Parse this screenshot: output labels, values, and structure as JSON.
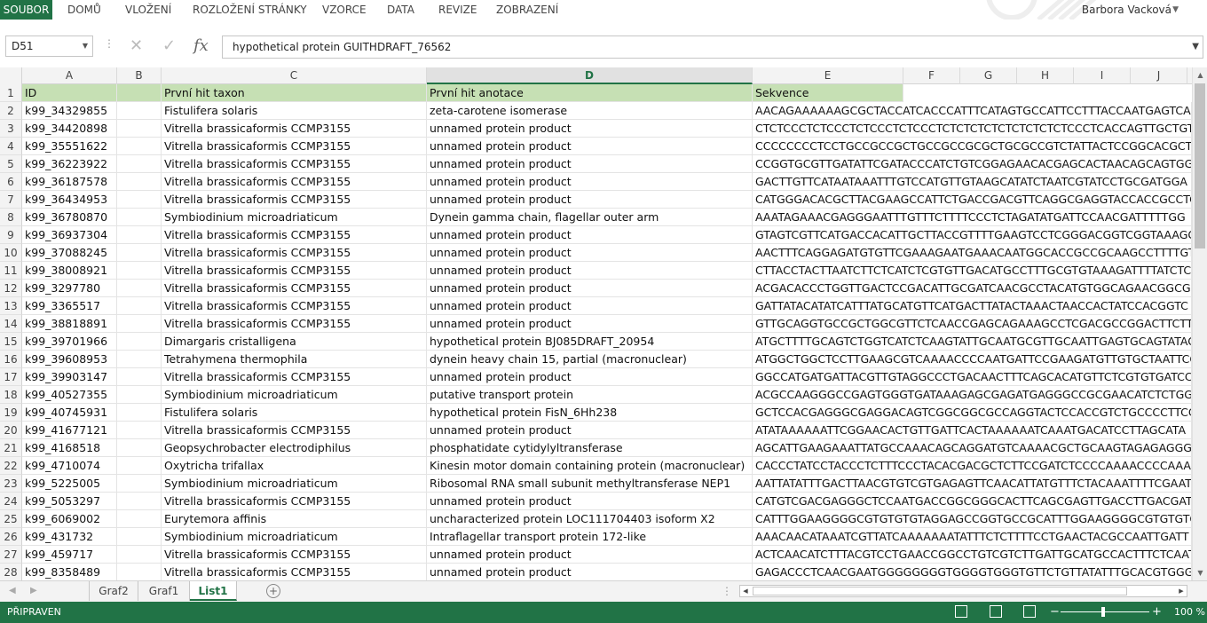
{
  "ribbon": {
    "tabs": [
      "SOUBOR",
      "DOMŮ",
      "VLOŽENÍ",
      "ROZLOŽENÍ STRÁNKY",
      "VZORCE",
      "DATA",
      "REVIZE",
      "ZOBRAZENÍ"
    ],
    "user": "Barbora Vacková"
  },
  "formula_bar": {
    "name_box": "D51",
    "formula": "hypothetical protein GUITHDRAFT_76562"
  },
  "columns": [
    "A",
    "B",
    "C",
    "D",
    "E",
    "F",
    "G",
    "H",
    "I",
    "J"
  ],
  "selected_column": "D",
  "header_row": {
    "row": "1",
    "A": "ID",
    "C": "První hit taxon",
    "D": "První hit anotace",
    "E": "Sekvence"
  },
  "rows": [
    {
      "n": "2",
      "A": "k99_34329855",
      "C": "Fistulifera solaris",
      "D": "zeta-carotene isomerase",
      "E": "AACAGAAAAAAGCGCTACCATCACCCATTTCATAGTGCCATTCCTTTACCAATGAGTCAA"
    },
    {
      "n": "3",
      "A": "k99_34420898",
      "C": "Vitrella brassicaformis CCMP3155",
      "D": "unnamed protein product",
      "E": "CTCTCCCTCTCCCTCTCCCTCTCCCTCTCTCTCTCTCTCTCTCTCCCTCACCAGTTGCTGT"
    },
    {
      "n": "4",
      "A": "k99_35551622",
      "C": "Vitrella brassicaformis CCMP3155",
      "D": "unnamed protein product",
      "E": "CCCCCCCCTCCTGCCGCCGCTGCCGCCGCGCTGCGCCGTCTATTACTCCGGCACGCTGG"
    },
    {
      "n": "5",
      "A": "k99_36223922",
      "C": "Vitrella brassicaformis CCMP3155",
      "D": "unnamed protein product",
      "E": "CCGGTGCGTTGATATTCGATACCCATCTGTCGGAGAACACGAGCACTAACAGCAGTGGT"
    },
    {
      "n": "6",
      "A": "k99_36187578",
      "C": "Vitrella brassicaformis CCMP3155",
      "D": "unnamed protein product",
      "E": "GACTTGTTCATAATAAATTTGTCCATGTTGTAAGCATATCTAATCGTATCCTGCGATGGA"
    },
    {
      "n": "7",
      "A": "k99_36434953",
      "C": "Vitrella brassicaformis CCMP3155",
      "D": "unnamed protein product",
      "E": "CATGGGACACGCTTACGAAGCCATTCTGACCGACGTTCAGGCGAGGTACCACCGCCTCT"
    },
    {
      "n": "8",
      "A": "k99_36780870",
      "C": "Symbiodinium microadriaticum",
      "D": "Dynein gamma chain, flagellar outer arm",
      "E": "AAATAGAAACGAGGGAATTTGTTTCTTTTCCCTCTAGATATGATTCCAACGATTTTTGG"
    },
    {
      "n": "9",
      "A": "k99_36937304",
      "C": "Vitrella brassicaformis CCMP3155",
      "D": "unnamed protein product",
      "E": "GTAGTCGTTCATGACCACATTGCTTACCGTTTTGAAGTCCTCGGGACGGTCGGTAAAGG"
    },
    {
      "n": "10",
      "A": "k99_37088245",
      "C": "Vitrella brassicaformis CCMP3155",
      "D": "unnamed protein product",
      "E": "AACTTTCAGGAGATGTGTTCGAAAGAATGAAACAATGGCACCGCCGCAAGCCTTTTGTT"
    },
    {
      "n": "11",
      "A": "k99_38008921",
      "C": "Vitrella brassicaformis CCMP3155",
      "D": "unnamed protein product",
      "E": "CTTACCTACTTAATCTTCTCATCTCGTGTTGACATGCCTTTGCGTGTAAAGATTTTATCTCA"
    },
    {
      "n": "12",
      "A": "k99_3297780",
      "C": "Vitrella brassicaformis CCMP3155",
      "D": "unnamed protein product",
      "E": "ACGACACCCTGGTTGACTCCGACATTGCGATCAACGCCTACATGTGGCAGAACGGCGG"
    },
    {
      "n": "13",
      "A": "k99_3365517",
      "C": "Vitrella brassicaformis CCMP3155",
      "D": "unnamed protein product",
      "E": "GATTATACATATCATTTATGCATGTTCATGACTTATACTAAACTAACCACTATCCACGGTC"
    },
    {
      "n": "14",
      "A": "k99_38818891",
      "C": "Vitrella brassicaformis CCMP3155",
      "D": "unnamed protein product",
      "E": "GTTGCAGGTGCCGCTGGCGTTCTCAACCGAGCAGAAAGCCTCGACGCCGGACTTCTTGG"
    },
    {
      "n": "15",
      "A": "k99_39701966",
      "C": "Dimargaris cristalligena",
      "D": "hypothetical protein BJ085DRAFT_20954",
      "E": "ATGCTTTTGCAGTCTGGTCATCTCAAGTATTGCAATGCGTTGCAATTGAGTGCAGTATAG"
    },
    {
      "n": "16",
      "A": "k99_39608953",
      "C": "Tetrahymena thermophila",
      "D": "dynein heavy chain 15, partial (macronuclear)",
      "E": "ATGGCTGGCTCCTTGAAGCGTCAAAACCCCAATGATTCCGAAGATGTTGTGCTAATTCGT"
    },
    {
      "n": "17",
      "A": "k99_39903147",
      "C": "Vitrella brassicaformis CCMP3155",
      "D": "unnamed protein product",
      "E": "GGCCATGATGATTACGTTGTAGGCCCTGACAACTTTCAGCACATGTTCTCGTGTGATCCT"
    },
    {
      "n": "18",
      "A": "k99_40527355",
      "C": "Symbiodinium microadriaticum",
      "D": "putative transport protein",
      "E": "ACGCCAAGGGCCGAGTGGGTGATAAAGAGCGAGATGAGGGCCGCGAACATCTCTGGG"
    },
    {
      "n": "19",
      "A": "k99_40745931",
      "C": "Fistulifera solaris",
      "D": "hypothetical protein FisN_6Hh238",
      "E": "GCTCCACGAGGGCGAGGACAGTCGGCGGCGCCAGGTACTCCACCGTCTGCCCCTTCCG"
    },
    {
      "n": "20",
      "A": "k99_41677121",
      "C": "Vitrella brassicaformis CCMP3155",
      "D": "unnamed protein product",
      "E": "ATATAAAAAATTCGGAACACTGTTGATTCACTAAAAAATCAAATGACATCCTTAGCATA"
    },
    {
      "n": "21",
      "A": "k99_4168518",
      "C": "Geopsychrobacter electrodiphilus",
      "D": "phosphatidate cytidylyltransferase",
      "E": "AGCATTGAAGAAATTATGCCAAACAGCAGGATGTCAAAACGCTGCAAGTAGAGAGGGA"
    },
    {
      "n": "22",
      "A": "k99_4710074",
      "C": "Oxytricha trifallax",
      "D": "Kinesin motor domain containing protein (macronuclear)",
      "E": "CACCCTATCCTACCCTCTTTCCCTACACGACGCTCTTCCGATCTCCCCAAAACCCCAAAA"
    },
    {
      "n": "23",
      "A": "k99_5225005",
      "C": "Symbiodinium microadriaticum",
      "D": "Ribosomal RNA small subunit methyltransferase NEP1",
      "E": "AATTATATTTGACTTAACGTGTCGTGAGAGTTCAACATTATGTTTCTACAAATTTTCGAAT"
    },
    {
      "n": "24",
      "A": "k99_5053297",
      "C": "Vitrella brassicaformis CCMP3155",
      "D": "unnamed protein product",
      "E": "CATGTCGACGAGGGCTCCAATGACCGGCGGGCACTTCAGCGAGTTGACCTTGACGATGT"
    },
    {
      "n": "25",
      "A": "k99_6069002",
      "C": "Eurytemora affinis",
      "D": "uncharacterized protein LOC111704403 isoform X2",
      "E": "CATTTGGAAGGGGCGTGTGTGTAGGAGCCGGTGCCGCATTTGGAAGGGGCGTGTGTGTA"
    },
    {
      "n": "26",
      "A": "k99_431732",
      "C": "Symbiodinium microadriaticum",
      "D": "Intraflagellar transport protein 172-like",
      "E": "AAACAACATAAATCGTTATCAAAAAAATATTTCTCTTTTCCTGAACTACGCCAATTGATT"
    },
    {
      "n": "27",
      "A": "k99_459717",
      "C": "Vitrella brassicaformis CCMP3155",
      "D": "unnamed protein product",
      "E": "ACTCAACATCTTTACGTCCTGAACCGGCCTGTCGTCTTGATTGCATGCCACTTTCTCAATT"
    },
    {
      "n": "28",
      "A": "k99_8358489",
      "C": "Vitrella brassicaformis CCMP3155",
      "D": "unnamed protein product",
      "E": "GAGACCCTCAACGAATGGGGGGGGTGGGGTGGGTGTTCTGTTATATTTGCACGTGGGGT"
    }
  ],
  "sheet_tabs": [
    "Graf2",
    "Graf1",
    "List1"
  ],
  "active_sheet": "List1",
  "status": {
    "ready": "PŘIPRAVEN",
    "zoom": "100 %"
  },
  "colors": {
    "accent": "#217346",
    "header_fill": "#c6e0b4"
  }
}
